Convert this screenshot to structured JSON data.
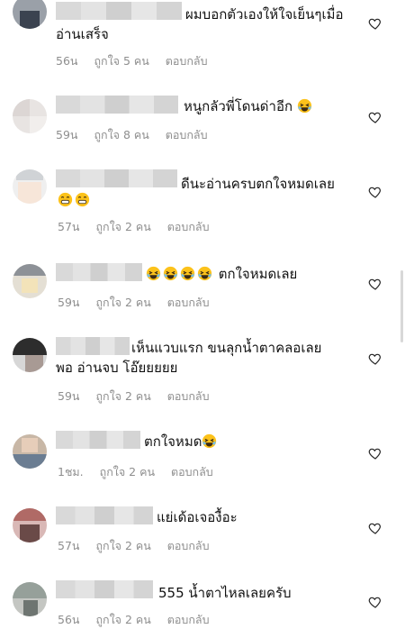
{
  "comments": [
    {
      "text": [
        "ผมบอกตัวเองให้ใจเย็นๆเมื่อ",
        "อ่านเสร็จ"
      ],
      "emoji": 0,
      "time": "56น",
      "likes": "ถูกใจ 5 คน",
      "reply": "ตอบกลับ"
    },
    {
      "text": [
        "หนูกลัวพี่โดนด่าอีก"
      ],
      "emoji": 1,
      "time": "59น",
      "likes": "ถูกใจ 8 คน",
      "reply": "ตอบกลับ"
    },
    {
      "text": [
        "ดีนะอ่านครบตกใจหมดเลย"
      ],
      "emoji": 2,
      "time": "57น",
      "likes": "ถูกใจ 2 คน",
      "reply": "ตอบกลับ"
    },
    {
      "text": [
        "ตกใจหมดเลย"
      ],
      "emoji": 4,
      "time": "59น",
      "likes": "ถูกใจ 2 คน",
      "reply": "ตอบกลับ"
    },
    {
      "text": [
        "เห็นแวบแรก ขนลุกน้ำตาคลอเลย",
        "พอ อ่านจบ โอ๊ยยยยย"
      ],
      "emoji": 0,
      "time": "59น",
      "likes": "ถูกใจ 2 คน",
      "reply": "ตอบกลับ"
    },
    {
      "text": [
        "ตกใจหมด"
      ],
      "emoji": 1,
      "time": "1ชม.",
      "likes": "ถูกใจ 2 คน",
      "reply": "ตอบกลับ"
    },
    {
      "text": [
        "แย่เด้อเจองื้อะ"
      ],
      "emoji": 0,
      "time": "57น",
      "likes": "ถูกใจ 2 คน",
      "reply": "ตอบกลับ"
    },
    {
      "text": [
        "555 น้ำตาไหลเลยครับ"
      ],
      "emoji": 0,
      "time": "56น",
      "likes": "ถูกใจ 2 คน",
      "reply": "ตอบกลับ"
    }
  ],
  "icons": {
    "like": "heart-outline-icon",
    "emoji": "laughing-emoji-icon"
  },
  "colors": {
    "text": "#111111",
    "meta": "#8e8e8e",
    "heart": "#262626"
  }
}
